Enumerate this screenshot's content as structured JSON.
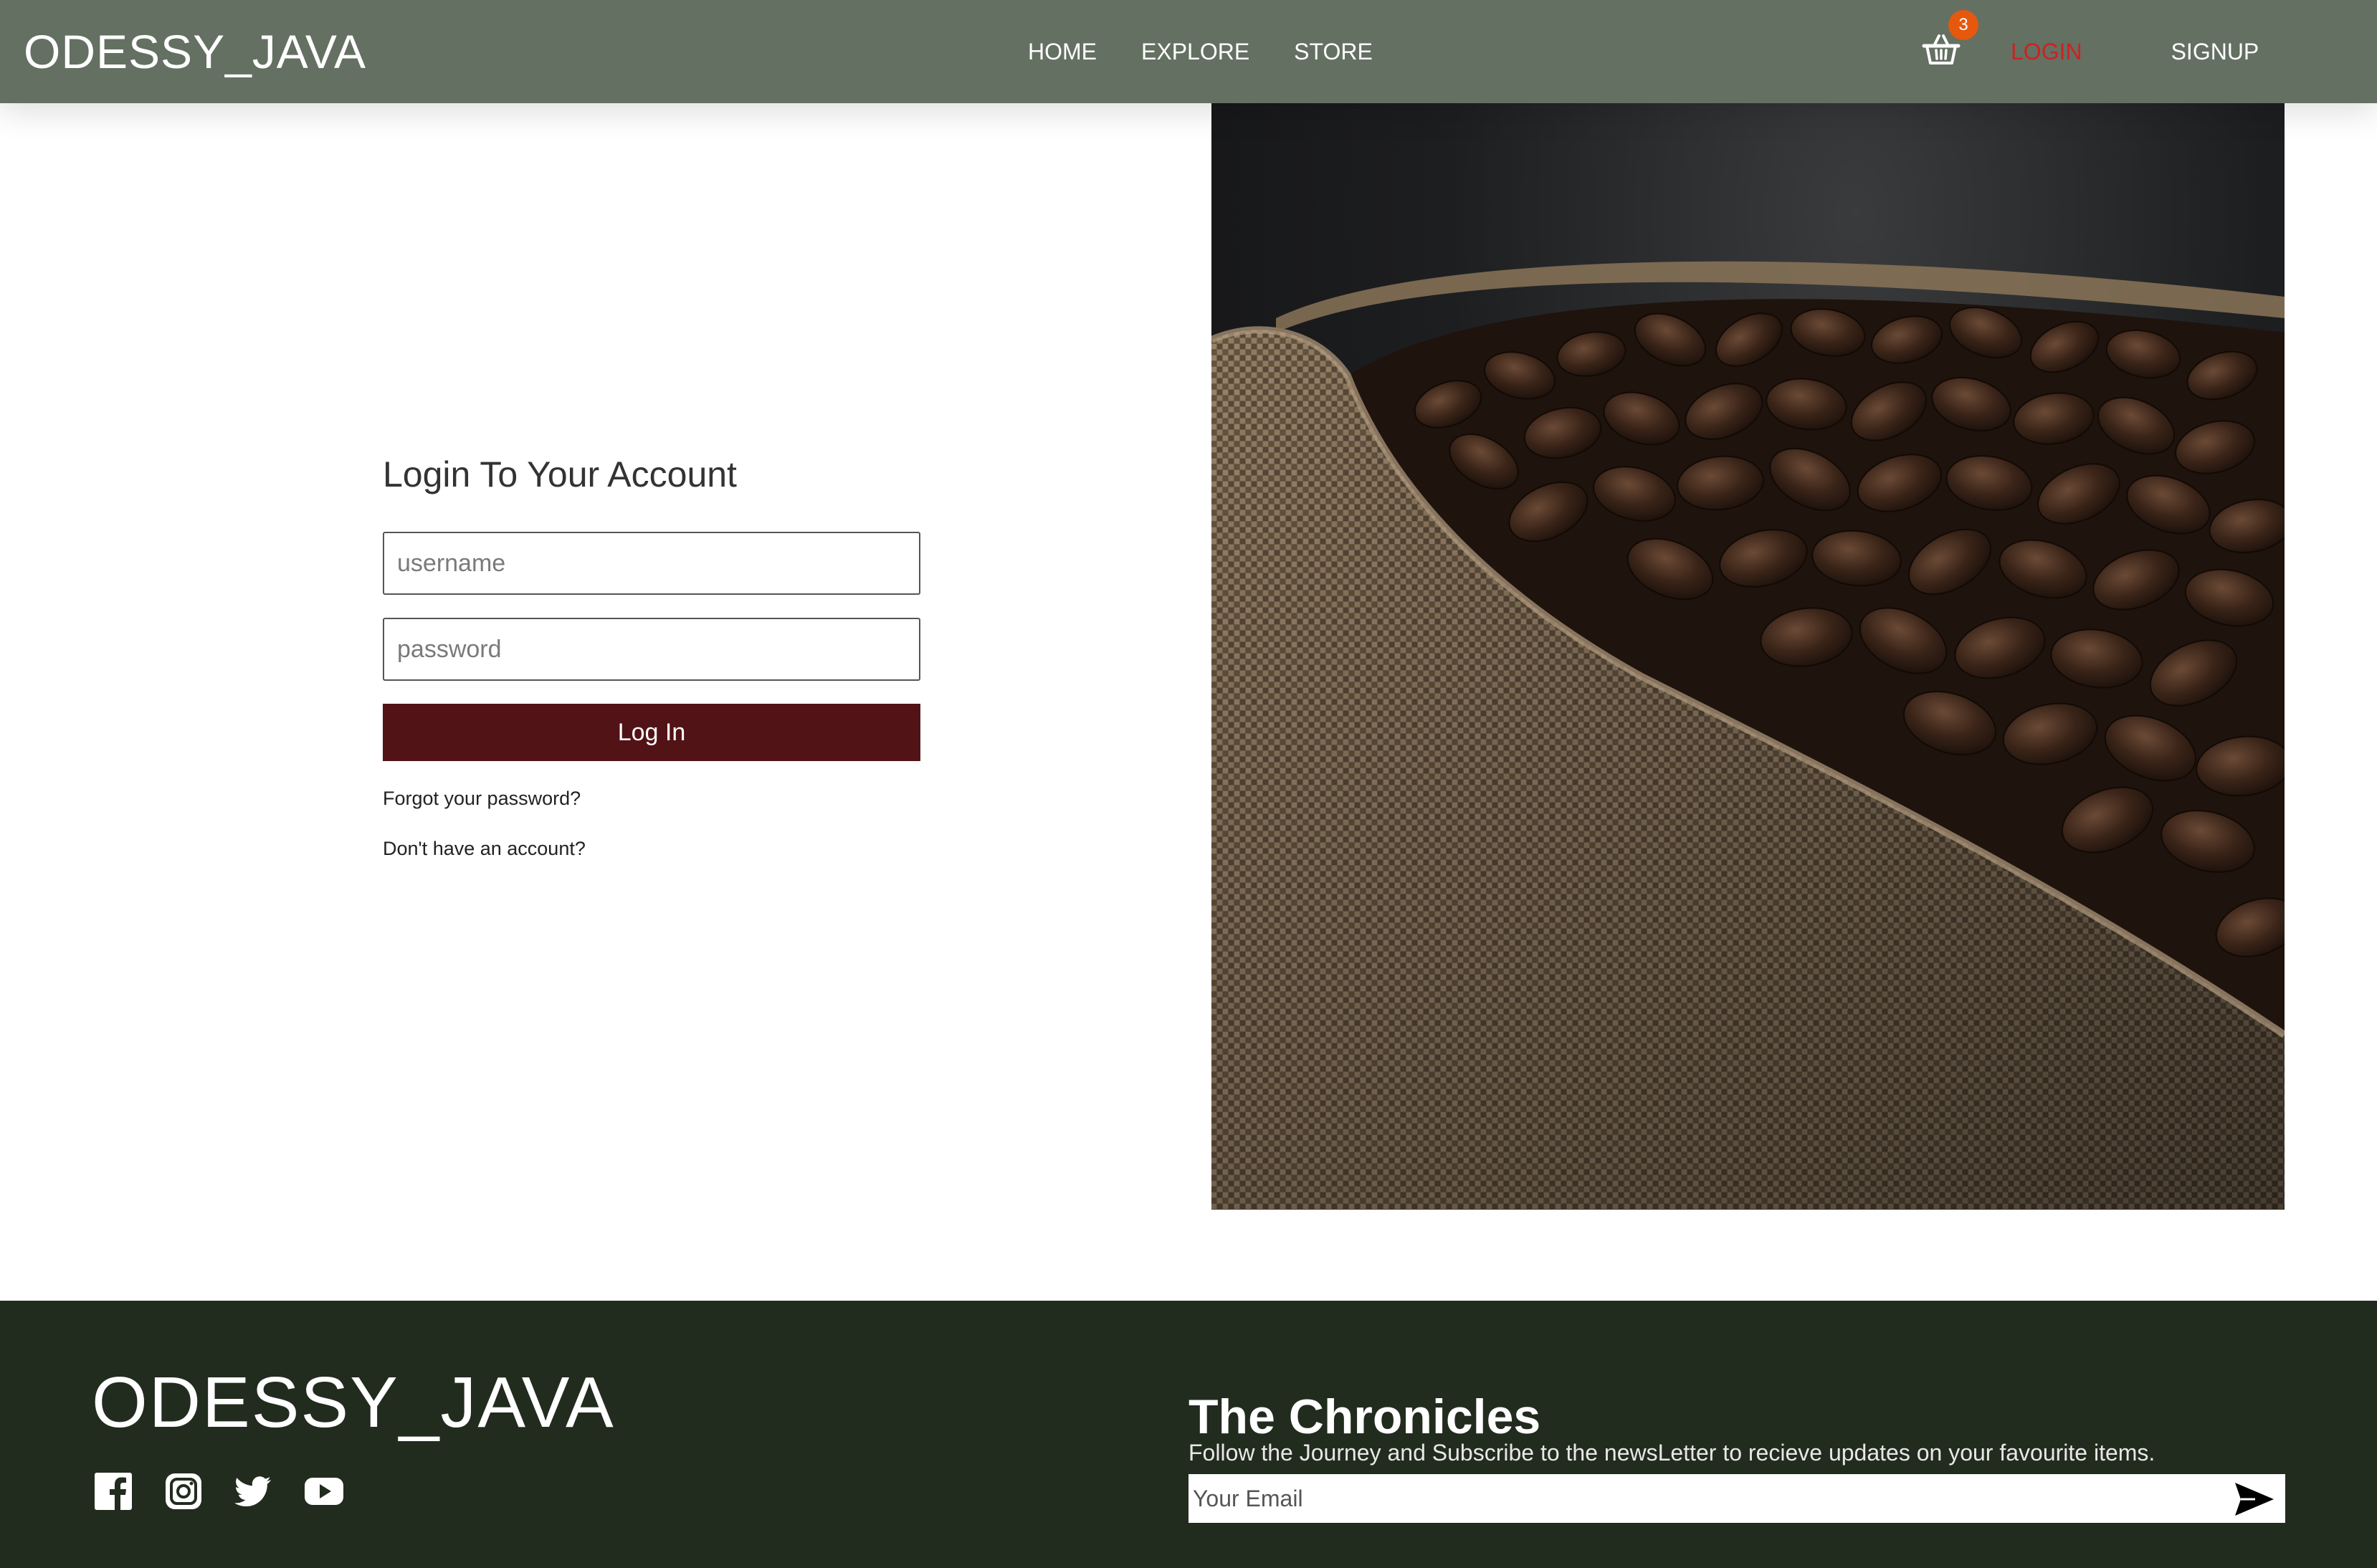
{
  "header": {
    "brand": "ODESSY_JAVA",
    "nav": {
      "home": "HOME",
      "explore": "EXPLORE",
      "store": "STORE"
    },
    "cart": {
      "icon": "basket-icon",
      "count": "3"
    },
    "auth": {
      "login": "LOGIN",
      "signup": "SIGNUP"
    },
    "colors": {
      "background": "#647062",
      "active_link": "#cc2222",
      "badge": "#e5580e"
    }
  },
  "hero": {
    "image": "coffee-beans-in-burlap-sack"
  },
  "login": {
    "title": "Login To Your Account",
    "username_placeholder": "username",
    "password_placeholder": "password",
    "submit_label": "Log In",
    "forgot_link": "Forgot your password?",
    "signup_link": "Don't have an account?",
    "button_color": "#521316"
  },
  "footer": {
    "brand": "ODESSY_JAVA",
    "socials": [
      "facebook-icon",
      "instagram-icon",
      "twitter-icon",
      "youtube-icon"
    ],
    "newsletter": {
      "title": "The Chronicles",
      "subtitle": "Follow the Journey and Subscribe to the newsLetter to recieve updates on your favourite items.",
      "email_placeholder": "Your Email",
      "send_icon": "send-icon"
    },
    "background": "#222c1e"
  }
}
